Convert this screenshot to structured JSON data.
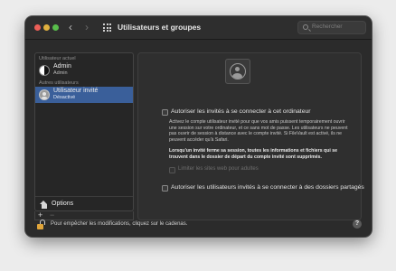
{
  "window": {
    "title": "Utilisateurs et groupes",
    "search_placeholder": "Rechercher"
  },
  "nav": {
    "back": "‹",
    "forward": "›"
  },
  "sidebar": {
    "current_user_section": "Utilisateur actuel",
    "other_users_section": "Autres utilisateurs",
    "users": [
      {
        "name": "Admin",
        "role": "Admin",
        "avatar": "yin-yang-icon",
        "selected": false
      },
      {
        "name": "Utilisateur invité",
        "role": "Désactivé",
        "avatar": "guest-icon",
        "selected": true
      }
    ],
    "options_label": "Options",
    "add_label": "+",
    "remove_label": "−"
  },
  "panel": {
    "allow_login_label": "Autoriser les invités à se connecter à cet ordinateur",
    "description": "Activez le compte utilisateur invité pour que vos amis puissent temporairement ouvrir une session sur votre ordinateur, et ce sans mot de passe. Les utilisateurs ne peuvent pas ouvrir de session à distance avec le compte invité. Si FileVault est activé, ils ne peuvent accéder qu'à Safari.",
    "warning": "Lorsqu'un invité ferme sa session, toutes les informations et fichiers qui se trouvent dans le dossier de départ du compte invité sont supprimés.",
    "limit_sites_label": "Limiter les sites web pour adultes",
    "shared_folders_label": "Autoriser les utilisateurs invités à se connecter à des dossiers partagés"
  },
  "footer": {
    "lock_text": "Pour empêcher les modifications, cliquez sur le cadenas.",
    "help": "?"
  },
  "colors": {
    "selection": "#3a5f9a",
    "window_bg": "#2b2b2b",
    "lock": "#e0a53a"
  }
}
